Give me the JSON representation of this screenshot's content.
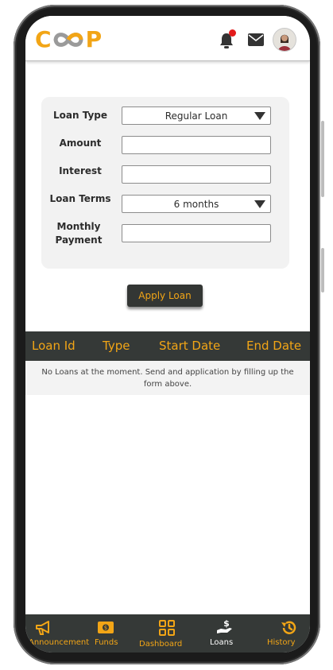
{
  "header": {
    "logo_parts": [
      "C",
      "P"
    ],
    "logo_text": "COOP",
    "notification_icon": "bell-icon",
    "mail_icon": "envelope-icon",
    "avatar_icon": "user-avatar"
  },
  "form": {
    "loan_type_label": "Loan Type",
    "loan_type_value": "Regular Loan",
    "amount_label": "Amount",
    "amount_value": "",
    "interest_label": "Interest",
    "interest_value": "",
    "loan_terms_label": "Loan Terms",
    "loan_terms_value": "6 months",
    "monthly_payment_label_line1": "Monthly",
    "monthly_payment_label_line2": "Payment",
    "monthly_payment_value": ""
  },
  "apply_button": "Apply Loan",
  "table": {
    "headers": [
      "Loan Id",
      "Type",
      "Start Date",
      "End Date"
    ],
    "empty_message": "No Loans at the moment. Send and application by filling up the form above."
  },
  "nav": {
    "items": [
      {
        "label": "Announcement",
        "icon": "megaphone-icon"
      },
      {
        "label": "Funds",
        "icon": "wallet-icon"
      },
      {
        "label": "Dashboard",
        "icon": "dashboard-icon"
      },
      {
        "label": "Loans",
        "icon": "hand-money-icon"
      },
      {
        "label": "History",
        "icon": "history-icon"
      }
    ],
    "active": "Loans"
  },
  "colors": {
    "accent": "#f2a516",
    "dark": "#353937",
    "card": "#f2f2f2",
    "badge": "#e31b1b"
  }
}
